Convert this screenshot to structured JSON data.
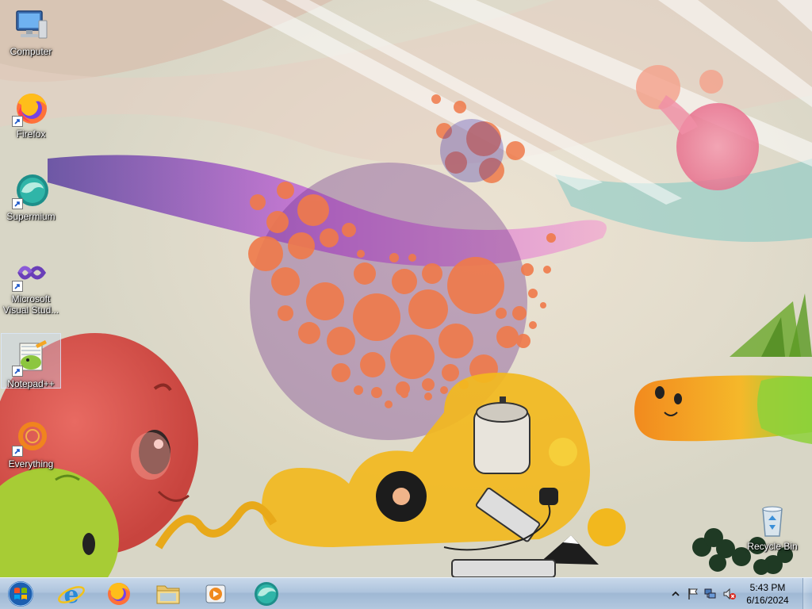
{
  "desktop": {
    "icons": [
      {
        "label": "Computer",
        "icon": "computer-icon",
        "shortcut": false
      },
      {
        "label": "Firefox",
        "icon": "firefox-icon",
        "shortcut": true
      },
      {
        "label": "Supermium",
        "icon": "supermium-icon",
        "shortcut": true
      },
      {
        "label": "Microsoft Visual Stud...",
        "icon": "visual-studio-icon",
        "shortcut": true
      },
      {
        "label": "Notepad++",
        "icon": "notepad-plus-plus-icon",
        "shortcut": true,
        "selected": true
      },
      {
        "label": "Everything",
        "icon": "everything-icon",
        "shortcut": true
      },
      {
        "label": "Recycle Bin",
        "icon": "recycle-bin-icon",
        "shortcut": false
      }
    ]
  },
  "taskbar": {
    "start": {
      "icon": "windows-start-icon"
    },
    "pinned": [
      {
        "name": "Internet Explorer",
        "icon": "internet-explorer-icon"
      },
      {
        "name": "Firefox",
        "icon": "firefox-icon"
      },
      {
        "name": "Windows Explorer",
        "icon": "folder-icon"
      },
      {
        "name": "Windows Media Player",
        "icon": "media-player-icon"
      },
      {
        "name": "Supermium",
        "icon": "supermium-icon"
      }
    ],
    "tray": {
      "icons": [
        "show-hidden-icons-chevron",
        "action-center-flag-icon",
        "network-icon",
        "volume-muted-icon"
      ],
      "time": "5:43 PM",
      "date": "6/16/2024"
    }
  },
  "colors": {
    "taskbar_top": "#c8d8ea",
    "taskbar_bottom": "#9fb8d4",
    "wallpaper_base": "#e2dccc",
    "accent_orange": "#f07a4a",
    "accent_yellow": "#f2b81e"
  }
}
